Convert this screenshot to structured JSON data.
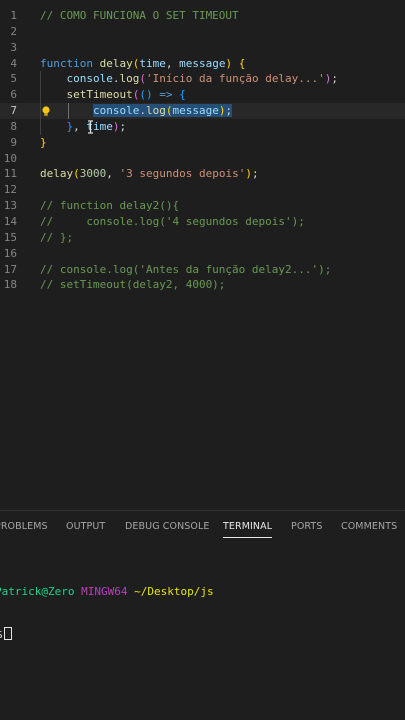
{
  "editor": {
    "lines": [
      {
        "n": "1",
        "tokens": [
          {
            "c": "cm",
            "t": "// COMO FUNCIONA O SET TIMEOUT"
          }
        ]
      },
      {
        "n": "2",
        "tokens": []
      },
      {
        "n": "3",
        "tokens": []
      },
      {
        "n": "4",
        "tokens": [
          {
            "c": "kw",
            "t": "function"
          },
          {
            "c": "punct",
            "t": " "
          },
          {
            "c": "fn",
            "t": "delay"
          },
          {
            "c": "br1",
            "t": "("
          },
          {
            "c": "pm",
            "t": "time"
          },
          {
            "c": "punct",
            "t": ", "
          },
          {
            "c": "pm",
            "t": "message"
          },
          {
            "c": "br1",
            "t": ")"
          },
          {
            "c": "punct",
            "t": " "
          },
          {
            "c": "br1",
            "t": "{"
          }
        ]
      },
      {
        "n": "5",
        "tokens": [
          {
            "c": "punct",
            "t": "    "
          },
          {
            "c": "pl",
            "t": "console"
          },
          {
            "c": "punct",
            "t": "."
          },
          {
            "c": "fn",
            "t": "log"
          },
          {
            "c": "br2",
            "t": "("
          },
          {
            "c": "str",
            "t": "'Início da função delay...'"
          },
          {
            "c": "br2",
            "t": ")"
          },
          {
            "c": "punct",
            "t": ";"
          }
        ]
      },
      {
        "n": "6",
        "tokens": [
          {
            "c": "punct",
            "t": "    "
          },
          {
            "c": "fn",
            "t": "setTimeout"
          },
          {
            "c": "br2",
            "t": "("
          },
          {
            "c": "br3",
            "t": "()"
          },
          {
            "c": "punct",
            "t": " "
          },
          {
            "c": "kw",
            "t": "=>"
          },
          {
            "c": "punct",
            "t": " "
          },
          {
            "c": "br3",
            "t": "{"
          }
        ]
      },
      {
        "n": "7",
        "active": true,
        "tokens": [
          {
            "c": "punct",
            "t": "        "
          },
          {
            "c": "pl sel",
            "t": "console"
          },
          {
            "c": "punct sel",
            "t": "."
          },
          {
            "c": "fn sel",
            "t": "log"
          },
          {
            "c": "br1 sel",
            "t": "("
          },
          {
            "c": "pm sel",
            "t": "message"
          },
          {
            "c": "br1 sel",
            "t": ")"
          },
          {
            "c": "punct sel",
            "t": ";"
          }
        ]
      },
      {
        "n": "8",
        "tokens": [
          {
            "c": "punct",
            "t": "    "
          },
          {
            "c": "br3",
            "t": "}"
          },
          {
            "c": "punct",
            "t": ", "
          },
          {
            "c": "pm",
            "t": "time"
          },
          {
            "c": "br2",
            "t": ")"
          },
          {
            "c": "punct",
            "t": ";"
          }
        ]
      },
      {
        "n": "9",
        "tokens": [
          {
            "c": "br1",
            "t": "}"
          }
        ]
      },
      {
        "n": "10",
        "tokens": []
      },
      {
        "n": "11",
        "tokens": [
          {
            "c": "fn",
            "t": "delay"
          },
          {
            "c": "br1",
            "t": "("
          },
          {
            "c": "num",
            "t": "3000"
          },
          {
            "c": "punct",
            "t": ", "
          },
          {
            "c": "str",
            "t": "'3 segundos depois'"
          },
          {
            "c": "br1",
            "t": ")"
          },
          {
            "c": "punct",
            "t": ";"
          }
        ]
      },
      {
        "n": "12",
        "tokens": []
      },
      {
        "n": "13",
        "tokens": [
          {
            "c": "cm",
            "t": "// function delay2(){"
          }
        ]
      },
      {
        "n": "14",
        "tokens": [
          {
            "c": "cm",
            "t": "//     console.log('4 segundos depois');"
          }
        ]
      },
      {
        "n": "15",
        "tokens": [
          {
            "c": "cm",
            "t": "// };"
          }
        ]
      },
      {
        "n": "16",
        "tokens": []
      },
      {
        "n": "17",
        "tokens": [
          {
            "c": "cm",
            "t": "// console.log('Antes da função delay2...');"
          }
        ]
      },
      {
        "n": "18",
        "tokens": [
          {
            "c": "cm",
            "t": "// setTimeout(delay2, 4000);"
          }
        ]
      }
    ]
  },
  "panel": {
    "tabs": [
      {
        "id": "problems",
        "label": "PROBLEMS"
      },
      {
        "id": "output",
        "label": "OUTPUT"
      },
      {
        "id": "debug-console",
        "label": "DEBUG CONSOLE"
      },
      {
        "id": "terminal",
        "label": "TERMINAL",
        "active": true
      },
      {
        "id": "ports",
        "label": "PORTS"
      },
      {
        "id": "comments",
        "label": "COMMENTS"
      }
    ]
  },
  "terminal": {
    "user": "Patrick@Zero",
    "host": "MINGW64",
    "path": "~/Desktop/js",
    "prompt": "$"
  },
  "icons": {
    "lightbulb": "lightbulb-icon",
    "text_cursor": "text-cursor-icon"
  },
  "colors": {
    "background": "#1e1e1e",
    "selection": "#264f78",
    "keyword": "#569cd6",
    "function": "#dcdcaa",
    "string": "#ce9178",
    "comment": "#6a9955",
    "number": "#b5cea8",
    "terminal_user": "#23d18b",
    "terminal_host": "#bc3fbc",
    "terminal_path": "#e5e510"
  }
}
